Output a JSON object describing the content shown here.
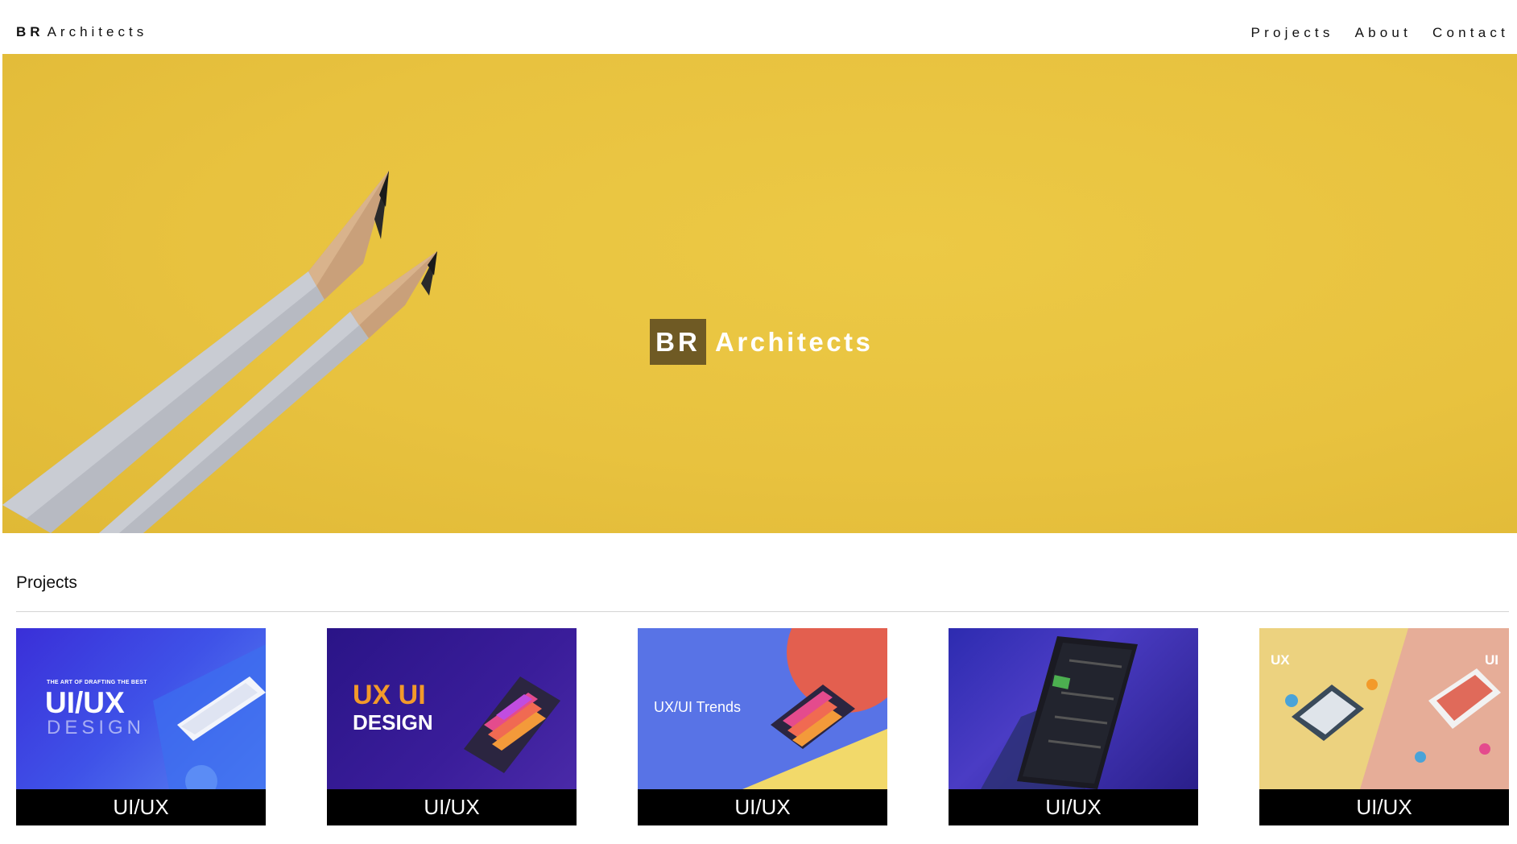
{
  "header": {
    "brand_bold": "BR",
    "brand_rest": "Architects",
    "nav": [
      "Projects",
      "About",
      "Contact"
    ]
  },
  "hero": {
    "title_box": "BR",
    "title_rest": "Architects",
    "background_color": "#e8c23f"
  },
  "projects": {
    "heading": "Projects",
    "cards": [
      {
        "caption": "UI/UX",
        "thumb_small": "THE ART OF DRAFTING THE BEST",
        "thumb_big": "UI/UX",
        "thumb_sub": "DESIGN"
      },
      {
        "caption": "UI/UX",
        "thumb_big": "UX UI",
        "thumb_sub": "DESIGN"
      },
      {
        "caption": "UI/UX",
        "thumb_big": "UX/UI Trends"
      },
      {
        "caption": "UI/UX"
      },
      {
        "caption": "UI/UX",
        "thumb_left": "UX",
        "thumb_right": "UI"
      }
    ]
  },
  "colors": {
    "accent_yellow": "#e8c23f",
    "title_box": "#6f5a24",
    "caption_bg": "#000000"
  }
}
